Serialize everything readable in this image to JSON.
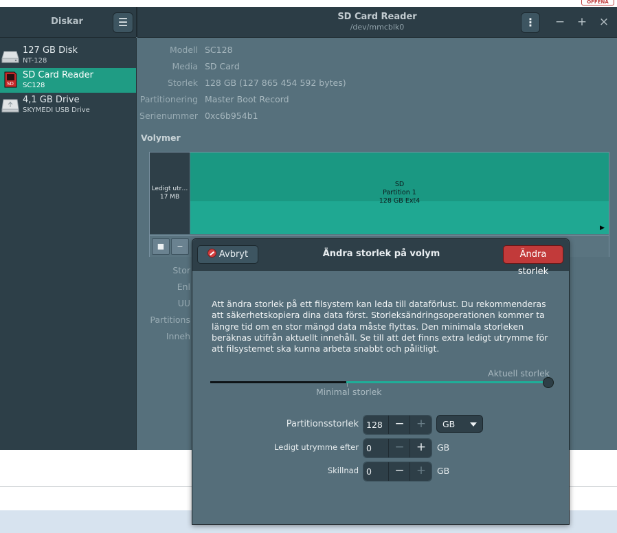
{
  "window": {
    "sidebar_title": "Diskar",
    "title": "SD Card Reader",
    "subtitle": "/dev/mmcblk0"
  },
  "background": {
    "badge": "OFFENA"
  },
  "devices": [
    {
      "name": "127 GB Disk",
      "sub": "NT-128",
      "icon": "hard-disk-icon",
      "selected": false
    },
    {
      "name": "SD Card Reader",
      "sub": "SC128",
      "icon": "sd-card-icon",
      "selected": true
    },
    {
      "name": "4,1 GB Drive",
      "sub": "SKYMEDI USB Drive",
      "icon": "usb-drive-icon",
      "selected": false
    }
  ],
  "properties": [
    {
      "label": "Modell",
      "value": "SC128"
    },
    {
      "label": "Media",
      "value": "SD Card"
    },
    {
      "label": "Storlek",
      "value": "128 GB (127 865 454 592 bytes)"
    },
    {
      "label": "Partitionering",
      "value": "Master Boot Record"
    },
    {
      "label": "Serienummer",
      "value": "0xc6b954b1"
    }
  ],
  "volumes": {
    "title": "Volymer",
    "free": {
      "label": "Ledigt utr…",
      "size": "17 MB"
    },
    "partition": {
      "line1": "SD",
      "line2": "Partition 1",
      "line3": "128 GB Ext4"
    },
    "toolbar": {
      "stop": "■",
      "minus": "−"
    },
    "detail_labels": [
      "Stor",
      "Enl",
      "UU",
      "Partitions",
      "Inneh"
    ]
  },
  "dialog": {
    "cancel_label": "Avbryt",
    "title": "Ändra storlek på volym",
    "apply_label": "Ändra storlek",
    "warning": "Att ändra storlek på ett filsystem kan leda till dataförlust. Du rekommenderas att säkerhetskopiera dina data först. Storleksändringsoperationen kommer ta längre tid om en stor mängd data måste flyttas. Den minimala storleken beräknas utifrån aktuellt innehåll. Se till att det finns extra ledigt utrymme för att filsystemet ska kunna arbeta snabbt och pålitligt.",
    "slider": {
      "current_label": "Aktuell storlek",
      "min_label": "Minimal storlek"
    },
    "fields": {
      "partition_size": {
        "label": "Partitionsstorlek",
        "value": "128",
        "unit": "GB"
      },
      "free_after": {
        "label": "Ledigt utrymme efter",
        "value": "0",
        "unit": "GB"
      },
      "difference": {
        "label": "Skillnad",
        "value": "0",
        "unit": "GB"
      }
    },
    "minus": "−",
    "plus": "+"
  },
  "colors": {
    "accent": "#1f9c84",
    "partition": "#1a9882",
    "danger": "#c23a3a",
    "header": "#2c3d46"
  }
}
